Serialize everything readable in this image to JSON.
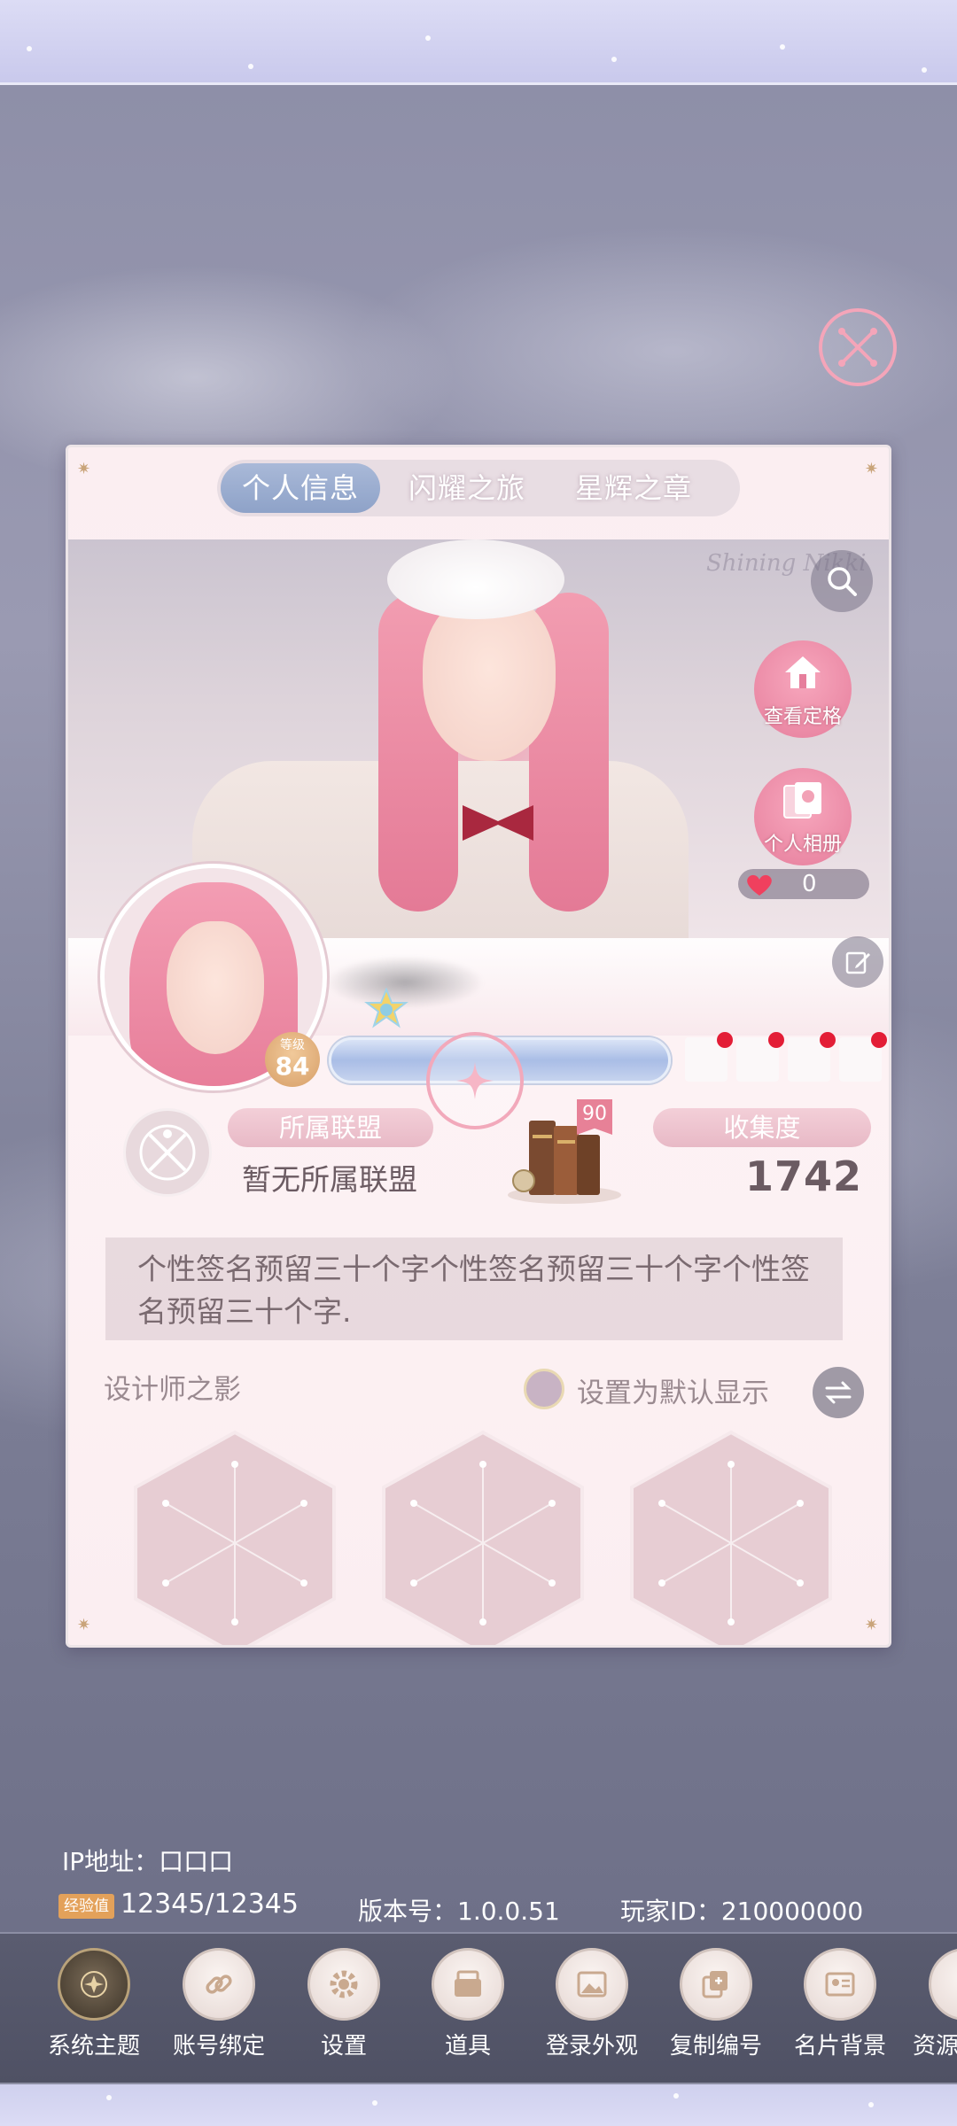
{
  "tabs": [
    {
      "label": "个人信息",
      "active": true
    },
    {
      "label": "闪耀之旅",
      "active": false
    },
    {
      "label": "星辉之章",
      "active": false
    }
  ],
  "profile": {
    "logo_text": "Shining Nikki",
    "view_outfit_label": "查看定格",
    "album_label": "个人相册",
    "likes": "0",
    "level_caption": "等级",
    "level": "84"
  },
  "alliance": {
    "title": "所属联盟",
    "value": "暂无所属联盟"
  },
  "books_badge": "90",
  "collection": {
    "title": "收集度",
    "value": "1742"
  },
  "signature": "个性签名预留三十个字个性签名预留三十个字个性签名预留三十个字.",
  "designer_shadow": {
    "title": "设计师之影",
    "default_label": "设置为默认显示"
  },
  "footer": {
    "ip": "IP地址：口口口",
    "exp_tag": "经验值",
    "exp_value": "12345/12345",
    "version": "版本号：1.0.0.51",
    "player_id": "玩家ID：210000000"
  },
  "dock": [
    {
      "label": "系统主题",
      "icon": "theme-icon"
    },
    {
      "label": "账号绑定",
      "icon": "link-icon"
    },
    {
      "label": "设置",
      "icon": "gear-icon"
    },
    {
      "label": "道具",
      "icon": "wallet-icon"
    },
    {
      "label": "登录外观",
      "icon": "picture-icon"
    },
    {
      "label": "复制编号",
      "icon": "copy-icon"
    },
    {
      "label": "名片背景",
      "icon": "card-icon"
    },
    {
      "label": "资源",
      "icon": "resource-icon"
    }
  ],
  "colors": {
    "accent_pink": "#e67e9c",
    "tab_active": "#8ea2c8",
    "notification_red": "#e31d36",
    "exp_tag": "#e3a15a"
  }
}
